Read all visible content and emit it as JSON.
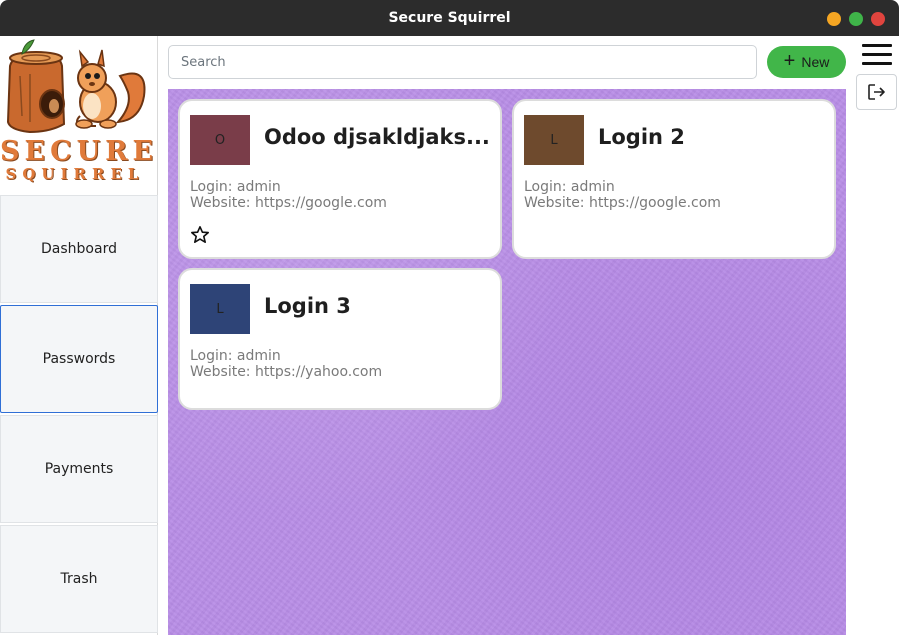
{
  "window": {
    "title": "Secure Squirrel"
  },
  "logo": {
    "line1": "SECURE",
    "line2": "SQUIRREL"
  },
  "sidebar": {
    "items": [
      {
        "label": "Dashboard"
      },
      {
        "label": "Passwords",
        "active": true
      },
      {
        "label": "Payments"
      },
      {
        "label": "Trash"
      }
    ]
  },
  "toolbar": {
    "search_placeholder": "Search",
    "search_value": "",
    "new_label": "New"
  },
  "cards": [
    {
      "initial": "O",
      "name": "Odoo djsakldjaks...",
      "login": "Login: admin",
      "website": "Website: https://google.com",
      "color": "#7a3d49",
      "favorite_icon": "star-outline-icon"
    },
    {
      "initial": "L",
      "name": "Login 2",
      "login": "Login: admin",
      "website": "Website: https://google.com",
      "color": "#6e4a2d"
    },
    {
      "initial": "L",
      "name": "Login 3",
      "login": "Login: admin",
      "website": "Website: https://yahoo.com",
      "color": "#2e4477"
    }
  ],
  "colors": {
    "titlebar": "#2c2c2c",
    "accent_green": "#41b649",
    "active_border": "#2f6fd6",
    "content_bg": "#b88de6"
  }
}
